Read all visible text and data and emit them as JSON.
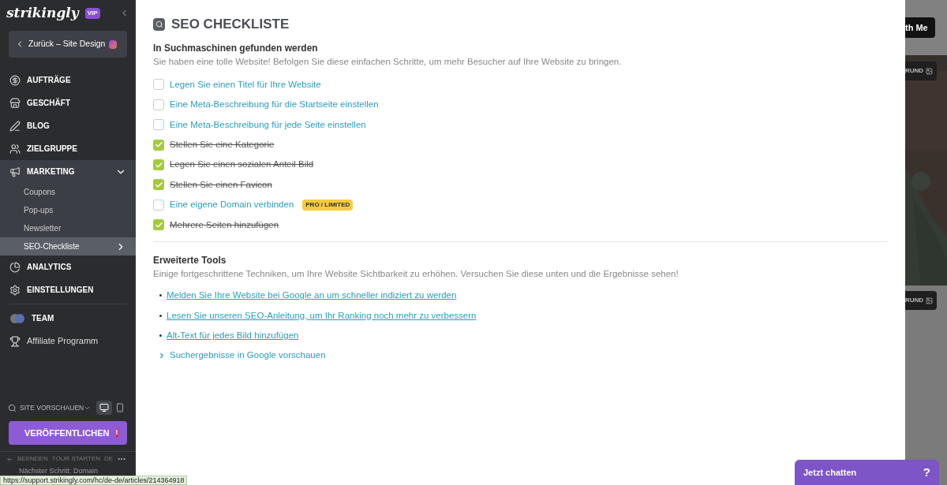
{
  "sidebar": {
    "logo": "strikingly",
    "badge": "VIP",
    "back_button": "Zurück – Site Design",
    "nav": [
      {
        "label": "AUFTRÄGE",
        "kind": "section",
        "selected": false
      },
      {
        "label": "GESCHÄFT",
        "kind": "section",
        "selected": false
      },
      {
        "label": "BLOG",
        "kind": "section",
        "selected": false
      },
      {
        "label": "ZIELGRUPPE",
        "kind": "section",
        "selected": false
      },
      {
        "label": "MARKETING",
        "kind": "section",
        "selected": false,
        "expanded": true,
        "children": [
          {
            "label": "Coupons",
            "selected": false
          },
          {
            "label": "Pop-ups",
            "selected": false
          },
          {
            "label": "Newsletter",
            "selected": false
          },
          {
            "label": "SEO-Checkliste",
            "selected": true
          }
        ]
      },
      {
        "label": "ANALYTICS",
        "kind": "section",
        "selected": false
      },
      {
        "label": "EINSTELLUNGEN",
        "kind": "section",
        "selected": false
      },
      {
        "label": "TEAM",
        "kind": "section",
        "selected": false
      },
      {
        "label": "Affiliate Programm",
        "kind": "link",
        "selected": false
      }
    ],
    "preview": "SITE VORSCHAUEN",
    "devices": [
      {
        "kind": "desktop",
        "selected": true
      },
      {
        "kind": "mobile",
        "selected": false
      }
    ],
    "publish": "VERÖFFENTLICHEN",
    "publish_alert": "!",
    "footer_links": [
      "BEENDEN",
      "TOUR STARTEN",
      "DE"
    ],
    "next_step": "Nächster Schritt: Domain"
  },
  "status_url": "https://support.strikingly.com/hc/de-de/articles/214364918",
  "main": {
    "title": "SEO CHECKLISTE",
    "section": {
      "heading": "In Suchmaschinen gefunden werden",
      "description": "Sie haben eine tolle Website! Befolgen Sie diese einfachen Schritte, um mehr Besucher auf Ihre Website zu bringen.",
      "items": [
        {
          "label": "Legen Sie einen Titel für Ihre Website",
          "checked": false
        },
        {
          "label": "Eine Meta-Beschreibung für die Startseite einstellen",
          "checked": false
        },
        {
          "label": "Eine Meta-Beschreibung für jede Seite einstellen",
          "checked": false
        },
        {
          "label": "Stellen Sie eine Kategorie",
          "checked": true
        },
        {
          "label": "Legen Sie einen sozialen Anteil Bild",
          "checked": true
        },
        {
          "label": "Stellen Sie einen Favicon",
          "checked": true
        },
        {
          "label": "Eine eigene Domain verbinden",
          "checked": false,
          "badge": "PRO / LIMITED"
        },
        {
          "label": "Mehrere Seiten hinzufügen",
          "checked": true
        }
      ]
    },
    "tools": {
      "heading": "Erweiterte Tools",
      "description": "Einige fortgeschrittene Techniken, um Ihre Website Sichtbarkeit zu erhöhen. Versuchen Sie diese unten und die Ergebnisse sehen!",
      "links": [
        "Melden Sie Ihre Website bei Google an um schneller indiziert zu werden",
        "Lesen Sie unseren SEO-Anleitung, um Ihr Ranking noch mehr zu verbessern",
        "Alt-Text für jedes Bild hinzufügen"
      ],
      "expander": {
        "label": "Suchergebnisse in Google vorschauen",
        "expanded": false
      }
    }
  },
  "background": {
    "button": "th Me",
    "labels": [
      "RUND",
      "RUND"
    ]
  },
  "chat": {
    "label": "Jetzt chatten",
    "help": "?"
  }
}
